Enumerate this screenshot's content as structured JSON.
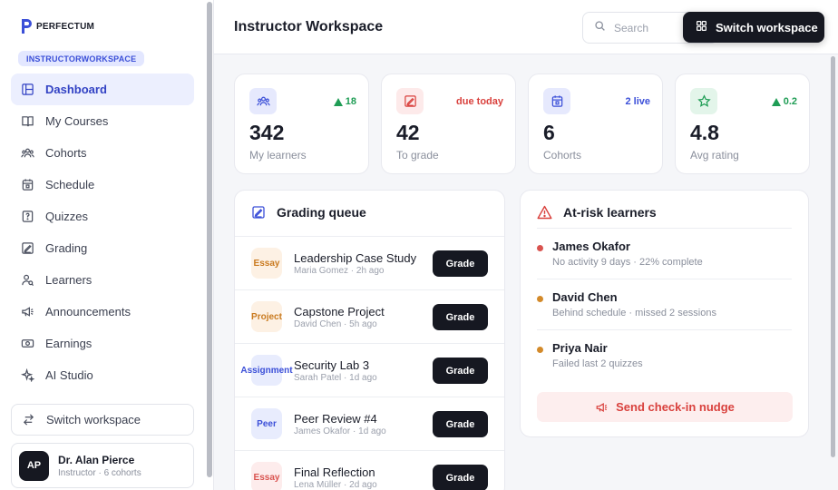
{
  "brand": {
    "name": "PERFECTUM"
  },
  "workspace_badge": "INSTRUCTORWORKSPACE",
  "sidebar": {
    "items": [
      {
        "label": "Dashboard",
        "icon": "layout-icon",
        "active": true
      },
      {
        "label": "My Courses",
        "icon": "book-icon"
      },
      {
        "label": "Cohorts",
        "icon": "users-icon"
      },
      {
        "label": "Schedule",
        "icon": "calendar-icon"
      },
      {
        "label": "Quizzes",
        "icon": "quiz-icon"
      },
      {
        "label": "Grading",
        "icon": "grading-icon"
      },
      {
        "label": "Learners",
        "icon": "learners-icon"
      },
      {
        "label": "Announcements",
        "icon": "megaphone-icon"
      },
      {
        "label": "Earnings",
        "icon": "cash-icon"
      },
      {
        "label": "AI Studio",
        "icon": "sparkle-icon"
      }
    ],
    "switch_label": "Switch workspace",
    "profile": {
      "initials": "AP",
      "name": "Dr. Alan Pierce",
      "subtitle": "Instructor · 6 cohorts"
    }
  },
  "header": {
    "title": "Instructor Workspace",
    "search_placeholder": "Search",
    "switch_button": "Switch workspace"
  },
  "stats": [
    {
      "value": "342",
      "label": "My learners",
      "badge": "18",
      "badge_type": "up",
      "icon": "users-icon",
      "accent": "#3b4fd8"
    },
    {
      "value": "42",
      "label": "To grade",
      "badge": "due today",
      "badge_type": "alert",
      "icon": "grading-icon",
      "accent": "#d9413d"
    },
    {
      "value": "6",
      "label": "Cohorts",
      "badge": "2 live",
      "badge_type": "info",
      "icon": "calendar-icon",
      "accent": "#3b4fd8"
    },
    {
      "value": "4.8",
      "label": "Avg rating",
      "badge": "0.2",
      "badge_type": "up",
      "icon": "star-icon",
      "accent": "#1f9d55"
    }
  ],
  "grading_queue": {
    "title": "Grading queue",
    "button_label": "Grade",
    "items": [
      {
        "type": "Essay",
        "title": "Leadership Case Study",
        "meta": "Maria Gomez · 2h ago"
      },
      {
        "type": "Project",
        "title": "Capstone Project",
        "meta": "David Chen · 5h ago"
      },
      {
        "type": "Assignment",
        "title": "Security Lab 3",
        "meta": "Sarah Patel · 1d ago"
      },
      {
        "type": "Peer",
        "title": "Peer Review #4",
        "meta": "James Okafor · 1d ago"
      },
      {
        "type": "Essay",
        "title": "Final Reflection",
        "meta": "Lena Müller · 2d ago"
      }
    ]
  },
  "at_risk": {
    "title": "At-risk learners",
    "learners": [
      {
        "name": "James Okafor",
        "detail": "No activity 9 days · 22% complete",
        "severity": "#d9534f"
      },
      {
        "name": "David Chen",
        "detail": "Behind schedule · missed 2 sessions",
        "severity": "#d38a2a"
      },
      {
        "name": "Priya Nair",
        "detail": "Failed last 2 quizzes",
        "severity": "#d38a2a"
      }
    ],
    "nudge_label": "Send check-in nudge"
  },
  "colors": {
    "accent": "#3b4fd8",
    "up": "#1f9d55",
    "alert": "#d9413d",
    "dark": "#161821"
  }
}
